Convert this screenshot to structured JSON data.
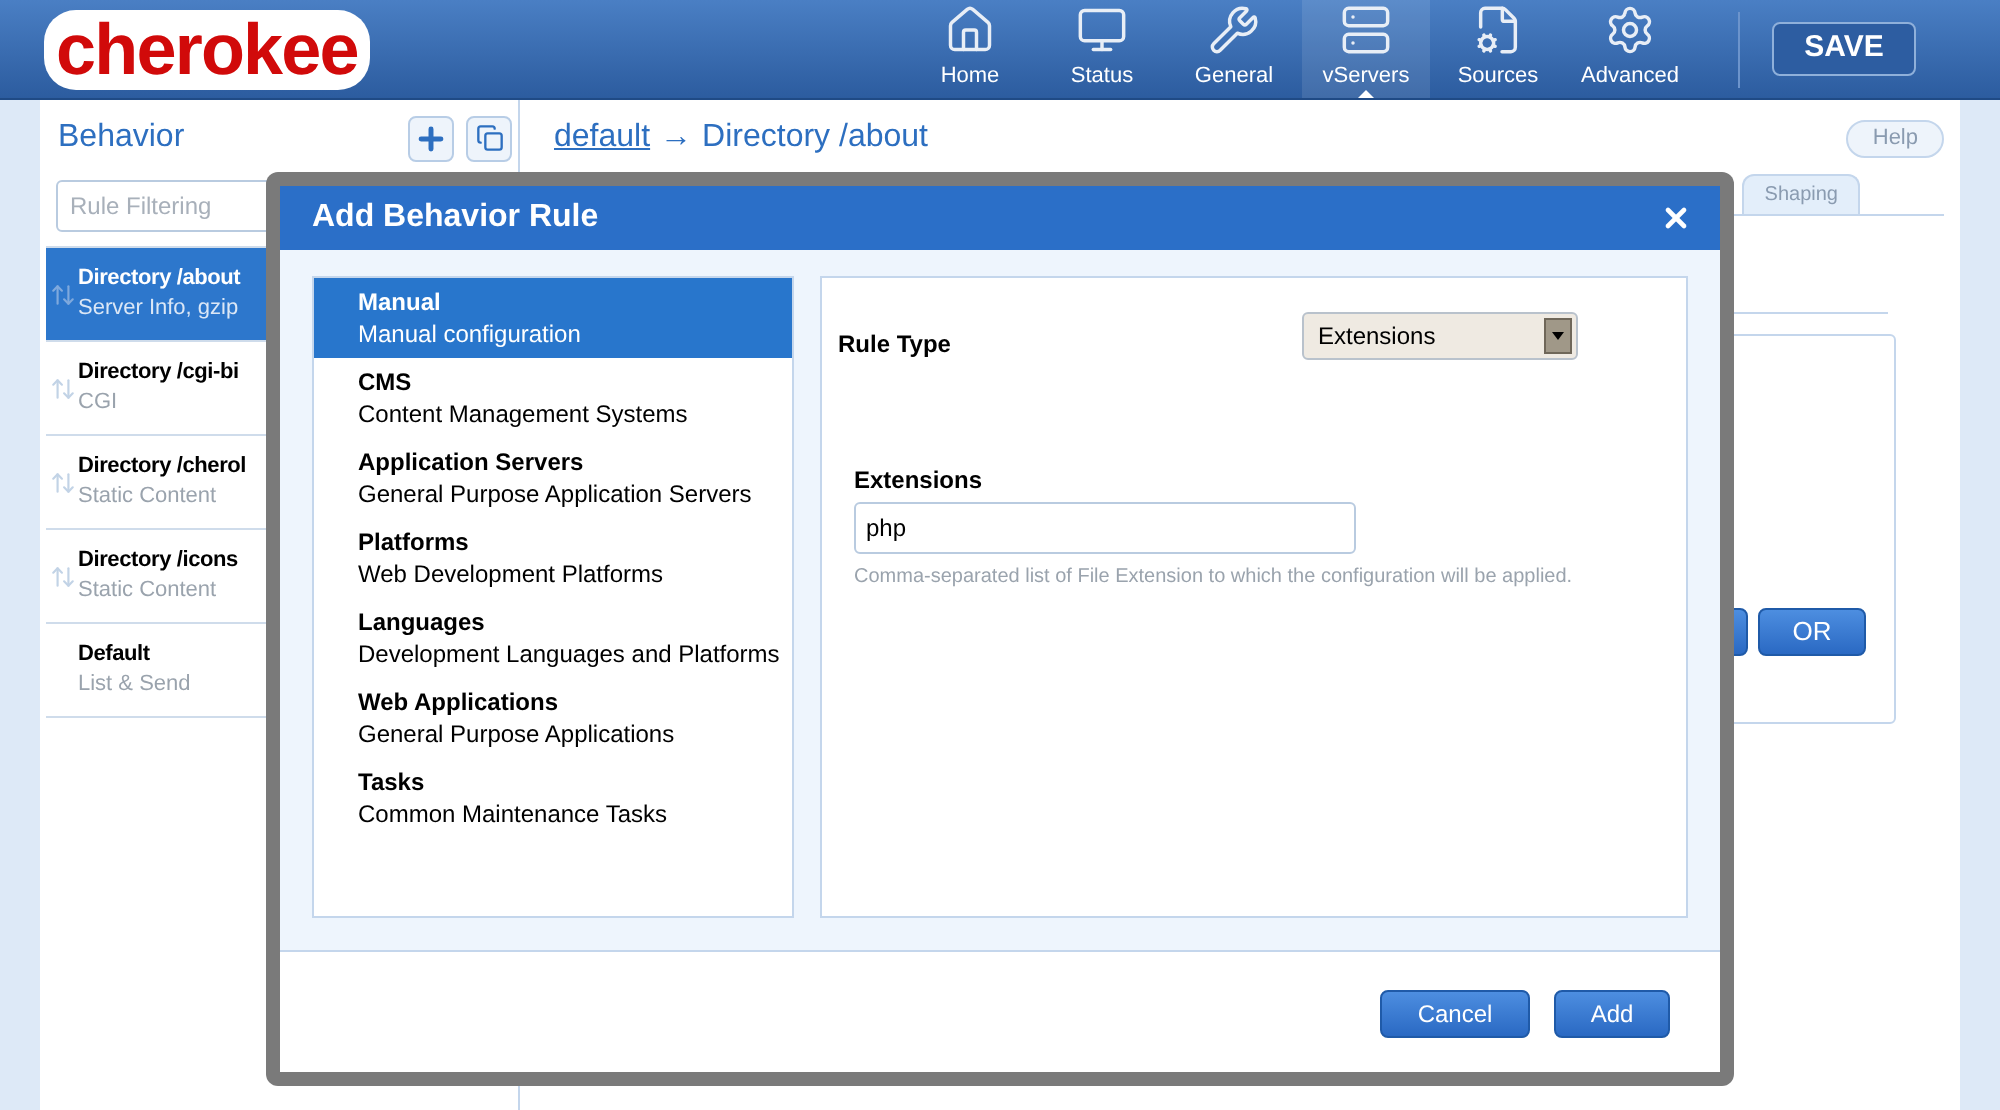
{
  "header": {
    "logo": "cherokee",
    "save": "SAVE",
    "nav": [
      {
        "label": "Home",
        "selected": false
      },
      {
        "label": "Status",
        "selected": false
      },
      {
        "label": "General",
        "selected": false
      },
      {
        "label": "vServers",
        "selected": true
      },
      {
        "label": "Sources",
        "selected": false
      },
      {
        "label": "Advanced",
        "selected": false
      }
    ]
  },
  "sidebar": {
    "title": "Behavior",
    "filter_placeholder": "Rule Filtering",
    "rules": [
      {
        "name": "Directory /about",
        "detail": "Server Info, gzip",
        "selected": true,
        "movable": true
      },
      {
        "name": "Directory /cgi-bi",
        "detail": "CGI",
        "selected": false,
        "movable": true
      },
      {
        "name": "Directory /cherol",
        "detail": "Static Content",
        "selected": false,
        "movable": true
      },
      {
        "name": "Directory /icons",
        "detail": "Static Content",
        "selected": false,
        "movable": true
      },
      {
        "name": "Default",
        "detail": "List & Send",
        "selected": false,
        "movable": false
      }
    ]
  },
  "content": {
    "breadcrumb_link": "default",
    "breadcrumb_arrow": "→",
    "breadcrumb_current": "Directory /about",
    "help": "Help",
    "tab": "Shaping",
    "buttons": [
      "OR"
    ]
  },
  "dialog": {
    "title": "Add Behavior Rule",
    "categories": [
      {
        "name": "Manual",
        "description": "Manual configuration",
        "selected": true
      },
      {
        "name": "CMS",
        "description": "Content Management Systems",
        "selected": false
      },
      {
        "name": "Application Servers",
        "description": "General Purpose Application Servers",
        "selected": false
      },
      {
        "name": "Platforms",
        "description": "Web Development Platforms",
        "selected": false
      },
      {
        "name": "Languages",
        "description": "Development Languages and Platforms",
        "selected": false
      },
      {
        "name": "Web Applications",
        "description": "General Purpose Applications",
        "selected": false
      },
      {
        "name": "Tasks",
        "description": "Common Maintenance Tasks",
        "selected": false
      }
    ],
    "rule_type_label": "Rule Type",
    "rule_type_value": "Extensions",
    "field_label": "Extensions",
    "field_value": "php",
    "field_hint": "Comma-separated list of File Extension to which the configuration will be applied.",
    "buttons": [
      "Cancel",
      "Add"
    ]
  }
}
